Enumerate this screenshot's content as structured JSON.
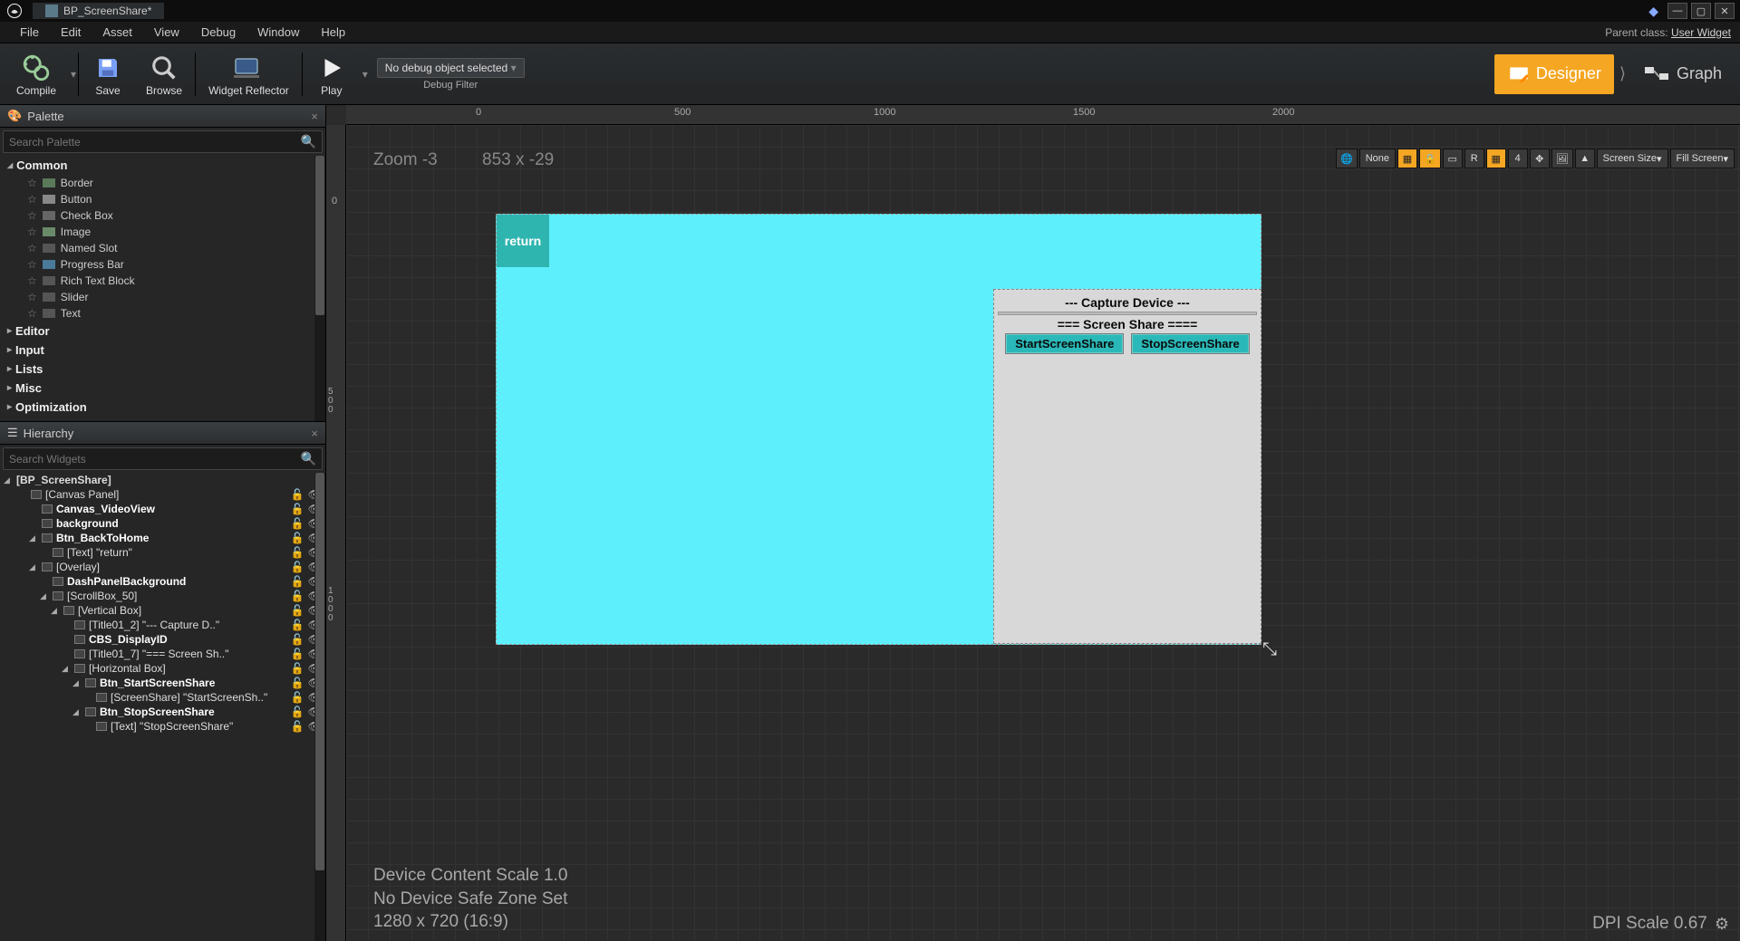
{
  "titlebar": {
    "tab_name": "BP_ScreenShare*"
  },
  "menubar": {
    "items": [
      "File",
      "Edit",
      "Asset",
      "View",
      "Debug",
      "Window",
      "Help"
    ],
    "parent_prefix": "Parent class:",
    "parent_link": "User Widget"
  },
  "toolbar": {
    "compile": "Compile",
    "save": "Save",
    "browse": "Browse",
    "widget_reflector": "Widget Reflector",
    "play": "Play",
    "debug_select": "No debug object selected",
    "debug_filter": "Debug Filter",
    "designer": "Designer",
    "graph": "Graph"
  },
  "palette": {
    "title": "Palette",
    "search_placeholder": "Search Palette",
    "categories": {
      "common": "Common",
      "editor": "Editor",
      "input": "Input",
      "lists": "Lists",
      "misc": "Misc",
      "optimization": "Optimization"
    },
    "common_items": [
      "Border",
      "Button",
      "Check Box",
      "Image",
      "Named Slot",
      "Progress Bar",
      "Rich Text Block",
      "Slider",
      "Text"
    ]
  },
  "hierarchy": {
    "title": "Hierarchy",
    "search_placeholder": "Search Widgets",
    "root": "[BP_ScreenShare]",
    "rows": [
      {
        "depth": 1,
        "label": "[Canvas Panel]"
      },
      {
        "depth": 2,
        "label": "Canvas_VideoView",
        "bold": true
      },
      {
        "depth": 2,
        "label": "background",
        "bold": true
      },
      {
        "depth": 2,
        "label": "Btn_BackToHome",
        "bold": true,
        "disc": true
      },
      {
        "depth": 3,
        "label": "[Text] \"return\""
      },
      {
        "depth": 2,
        "label": "[Overlay]",
        "disc": true
      },
      {
        "depth": 3,
        "label": "DashPanelBackground",
        "bold": true
      },
      {
        "depth": 3,
        "label": "[ScrollBox_50]",
        "disc": true
      },
      {
        "depth": 4,
        "label": "[Vertical Box]",
        "disc": true
      },
      {
        "depth": 5,
        "label": "[Title01_2] \"--- Capture D..\""
      },
      {
        "depth": 5,
        "label": "CBS_DisplayID",
        "bold": true
      },
      {
        "depth": 5,
        "label": "[Title01_7] \"=== Screen Sh..\""
      },
      {
        "depth": 5,
        "label": "[Horizontal Box]",
        "disc": true
      },
      {
        "depth": 6,
        "label": "Btn_StartScreenShare",
        "bold": true,
        "disc": true
      },
      {
        "depth": 7,
        "label": "[ScreenShare] \"StartScreenSh..\""
      },
      {
        "depth": 6,
        "label": "Btn_StopScreenShare",
        "bold": true,
        "disc": true
      },
      {
        "depth": 7,
        "label": "[Text] \"StopScreenShare\""
      }
    ]
  },
  "viewport": {
    "ruler_h": [
      "0",
      "500",
      "1000",
      "1500",
      "2000"
    ],
    "ruler_v_0": "0",
    "ruler_v_500": "500",
    "ruler_v_1000": "1000",
    "zoom": "Zoom -3",
    "coords": "853 x -29",
    "toolbar": {
      "localize": "None",
      "r_btn": "R",
      "number": "4",
      "screen_size": "Screen Size",
      "fill_screen": "Fill Screen"
    },
    "return_btn": "return",
    "capture_title": "--- Capture Device ---",
    "share_title": "=== Screen Share ====",
    "start_label": "StartScreenShare",
    "stop_label": "StopScreenShare",
    "bottom_line1": "Device Content Scale 1.0",
    "bottom_line2": "No Device Safe Zone Set",
    "bottom_line3": "1280 x 720 (16:9)",
    "dpi": "DPI Scale 0.67"
  }
}
